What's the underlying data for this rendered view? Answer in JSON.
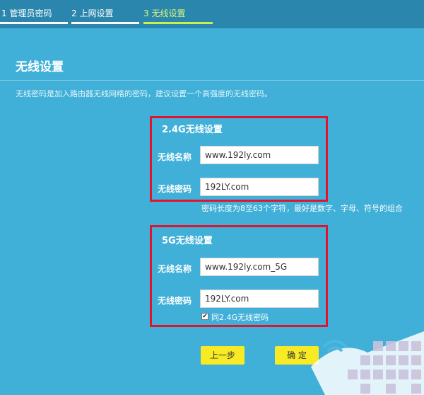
{
  "steps": [
    {
      "label": "1 管理员密码",
      "state": "done"
    },
    {
      "label": "2 上网设置",
      "state": "done"
    },
    {
      "label": "3 无线设置",
      "state": "active"
    }
  ],
  "page": {
    "title": "无线设置",
    "description": "无线密码是加入路由器无线网络的密码，建议设置一个高强度的无线密码。"
  },
  "band24": {
    "title": "2.4G无线设置",
    "name_label": "无线名称",
    "name_value": "www.192ly.com",
    "password_label": "无线密码",
    "password_value": "192LY.com",
    "hint": "密码长度为8至63个字符，最好是数字、字母、符号的组合"
  },
  "band5": {
    "title": "5G无线设置",
    "name_label": "无线名称",
    "name_value": "www.192ly.com_5G",
    "password_label": "无线密码",
    "password_value": "192LY.com",
    "same_password_label": "同2.4G无线密码",
    "same_password_checked": true
  },
  "buttons": {
    "prev": "上一步",
    "confirm": "确 定"
  },
  "colors": {
    "background": "#40b0d8",
    "step_done_line": "#ffffff",
    "step_active_line": "#c8f051",
    "highlight_box": "#e2142d",
    "button": "#f8ea25"
  }
}
